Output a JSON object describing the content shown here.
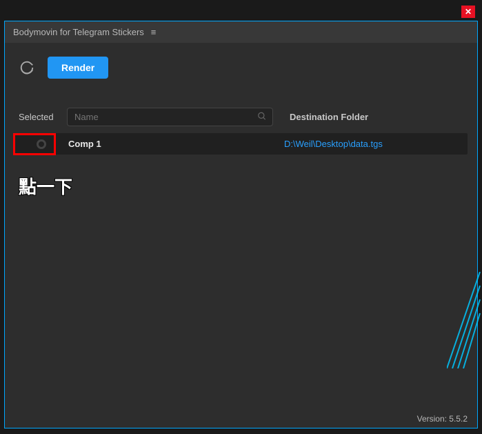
{
  "window": {
    "close_glyph": "✕"
  },
  "header": {
    "title": "Bodymovin for Telegram Stickers",
    "menu_glyph": "≡"
  },
  "toolbar": {
    "render_label": "Render"
  },
  "columns": {
    "selected": "Selected",
    "name_placeholder": "Name",
    "destination": "Destination Folder"
  },
  "rows": [
    {
      "name": "Comp 1",
      "destination": "D:\\Weil\\Desktop\\data.tgs"
    }
  ],
  "annotation": {
    "click_here": "點一下"
  },
  "footer": {
    "version_label": "Version: 5.5.2"
  }
}
